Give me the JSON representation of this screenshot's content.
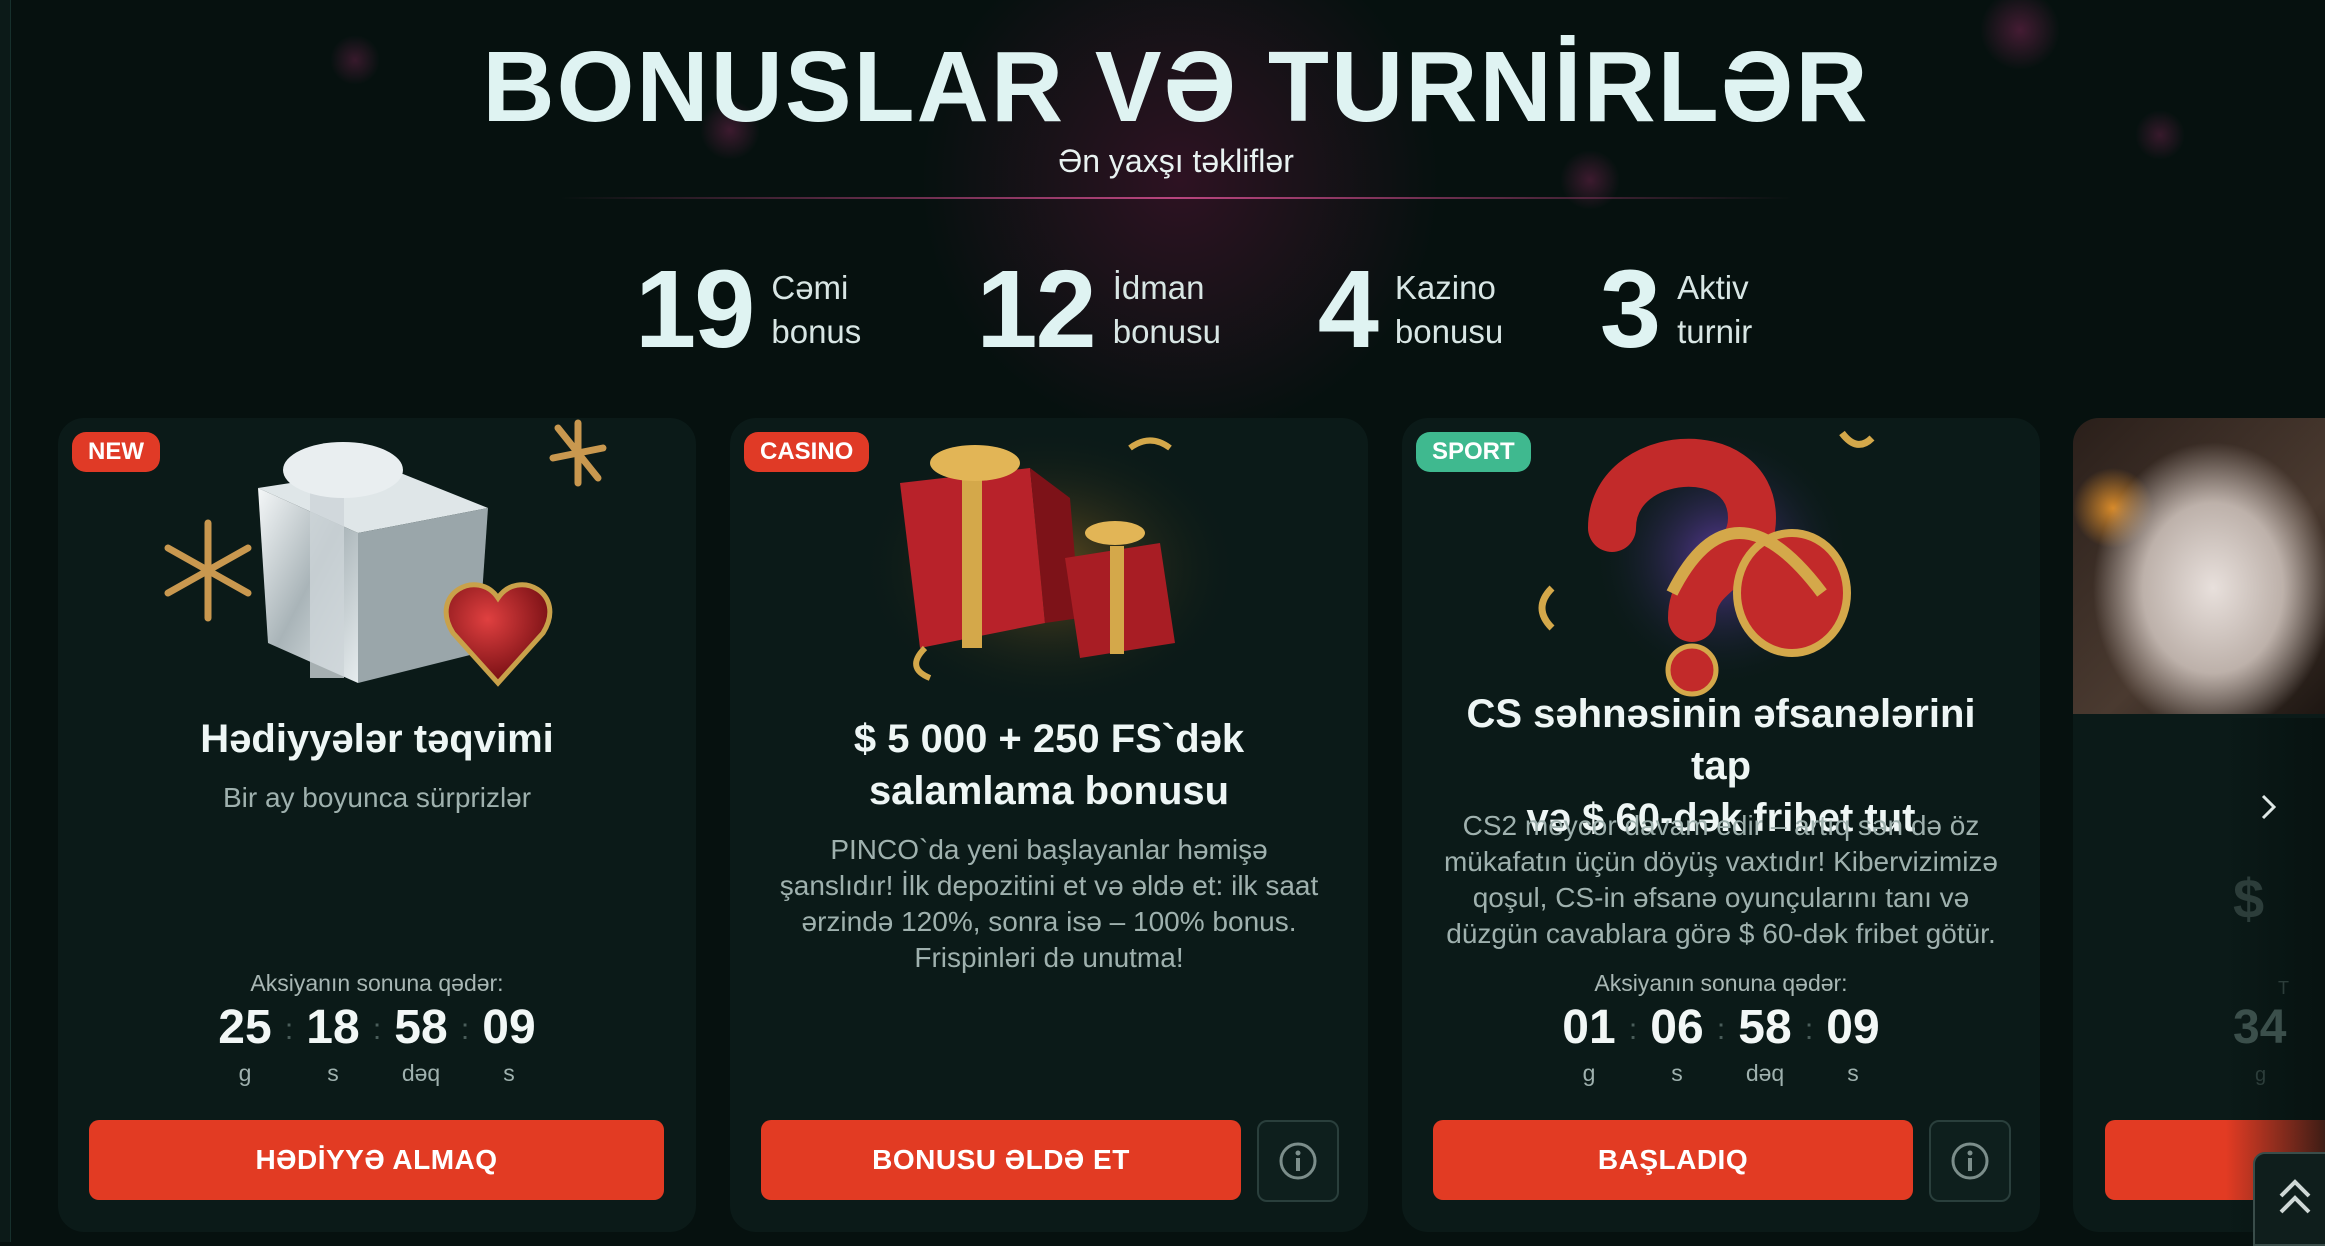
{
  "header": {
    "title": "BONUSLAR VƏ TURNİRLƏR",
    "subtitle": "Ən yaxşı təkliflər"
  },
  "stats": [
    {
      "value": "19",
      "label_line1": "Cəmi",
      "label_line2": "bonus"
    },
    {
      "value": "12",
      "label_line1": "İdman",
      "label_line2": "bonusu"
    },
    {
      "value": "4",
      "label_line1": "Kazino",
      "label_line2": "bonusu"
    },
    {
      "value": "3",
      "label_line1": "Aktiv",
      "label_line2": "turnir"
    }
  ],
  "cards": [
    {
      "badge": "NEW",
      "title": "Hədiyyələr təqvimi",
      "description": "Bir ay boyunca sürprizlər",
      "timer_label": "Aksiyanın sonuna qədər:",
      "timer": [
        {
          "value": "25",
          "unit": "g"
        },
        {
          "value": "18",
          "unit": "s"
        },
        {
          "value": "58",
          "unit": "dəq"
        },
        {
          "value": "09",
          "unit": "s"
        }
      ],
      "button": "HƏDİYYƏ ALMAQ"
    },
    {
      "badge": "CASINO",
      "title_line1": "$ 5 000 + 250 FS`dək",
      "title_line2": "salamlama bonusu",
      "description": "PINCO`da yeni başlayanlar həmişə şanslıdır! İlk depozitini et və əldə et: ilk saat ərzində 120%, sonra isə – 100% bonus. Frispinləri də unutma!",
      "button": "BONUSU ƏLDƏ ET"
    },
    {
      "badge": "SPORT",
      "title_line1": "CS səhnəsinin əfsanələrini tap",
      "title_line2": "və $ 60-dək fribet tut",
      "description": "CS2 meycor davam edir – artıq sən də öz mükafatın üçün döyüş vaxtıdır! Kibervizimizə qoşul, CS-in əfsanə oyunçularını tanı və düzgün cavablara görə $ 60-dək fribet götür.",
      "timer_label": "Aksiyanın sonuna qədər:",
      "timer": [
        {
          "value": "01",
          "unit": "g"
        },
        {
          "value": "06",
          "unit": "s"
        },
        {
          "value": "58",
          "unit": "dəq"
        },
        {
          "value": "09",
          "unit": "s"
        }
      ],
      "button": "BAŞLADIQ"
    },
    {
      "partial_amount": "$",
      "partial_timer_label": "T",
      "partial_timer_value": "34",
      "partial_timer_unit": "g"
    }
  ],
  "colors": {
    "accent": "#e23b23",
    "badge_red": "#e03a26",
    "badge_green": "#3fb98f",
    "background": "#06110f",
    "card": "#0b1a18"
  },
  "icons": {
    "info": "info-icon",
    "next": "chevron-right-icon",
    "scroll_top": "double-chevron-up-icon"
  }
}
